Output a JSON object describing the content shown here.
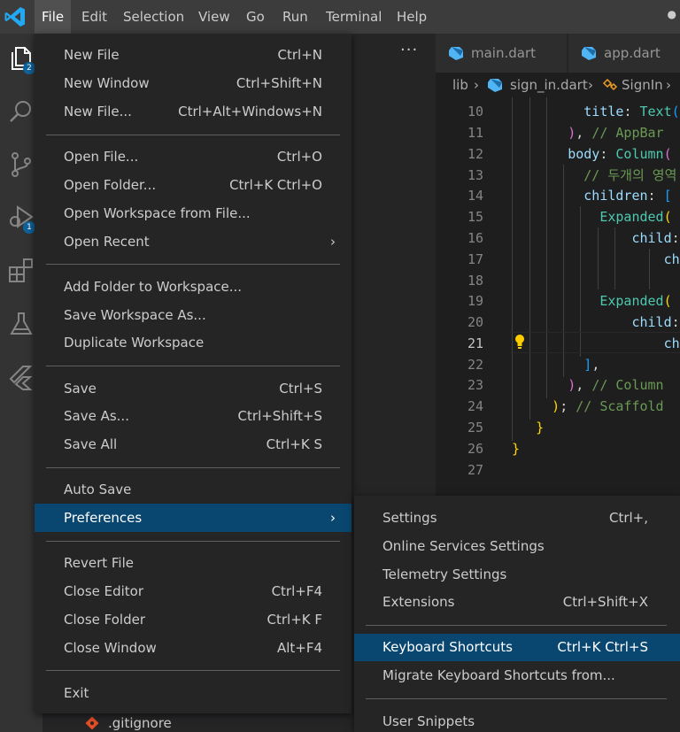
{
  "menubar": {
    "items": [
      "File",
      "Edit",
      "Selection",
      "View",
      "Go",
      "Run",
      "Terminal",
      "Help"
    ],
    "more": "●"
  },
  "activity": {
    "explorer_badge": "2",
    "debug_badge": "1",
    "accent": "#0e639c"
  },
  "sidebar": {
    "more": "···",
    "tree_item": ".gitignore"
  },
  "tabs": [
    {
      "label": "main.dart"
    },
    {
      "label": "app.dart"
    }
  ],
  "breadcrumb": {
    "folder": "lib",
    "file": "sign_in.dart",
    "symbol": "SignIn"
  },
  "editor": {
    "line_numbers": [
      "10",
      "11",
      "12",
      "13",
      "14",
      "15",
      "16",
      "17",
      "18",
      "19",
      "20",
      "21",
      "22",
      "23",
      "24",
      "25",
      "26",
      "27"
    ],
    "current_line": "21"
  },
  "file_menu": {
    "items": [
      {
        "label": "New File",
        "key": "Ctrl+N"
      },
      {
        "label": "New Window",
        "key": "Ctrl+Shift+N"
      },
      {
        "label": "New File...",
        "key": "Ctrl+Alt+Windows+N"
      },
      {
        "label": "Open File...",
        "key": "Ctrl+O"
      },
      {
        "label": "Open Folder...",
        "key": "Ctrl+K Ctrl+O"
      },
      {
        "label": "Open Workspace from File...",
        "key": ""
      },
      {
        "label": "Open Recent",
        "key": ""
      },
      {
        "label": "Add Folder to Workspace...",
        "key": ""
      },
      {
        "label": "Save Workspace As...",
        "key": ""
      },
      {
        "label": "Duplicate Workspace",
        "key": ""
      },
      {
        "label": "Save",
        "key": "Ctrl+S"
      },
      {
        "label": "Save As...",
        "key": "Ctrl+Shift+S"
      },
      {
        "label": "Save All",
        "key": "Ctrl+K S"
      },
      {
        "label": "Auto Save",
        "key": ""
      },
      {
        "label": "Preferences",
        "key": ""
      },
      {
        "label": "Revert File",
        "key": ""
      },
      {
        "label": "Close Editor",
        "key": "Ctrl+F4"
      },
      {
        "label": "Close Folder",
        "key": "Ctrl+K F"
      },
      {
        "label": "Close Window",
        "key": "Alt+F4"
      },
      {
        "label": "Exit",
        "key": ""
      }
    ]
  },
  "pref_menu": {
    "items": [
      {
        "label": "Settings",
        "key": "Ctrl+,"
      },
      {
        "label": "Online Services Settings",
        "key": ""
      },
      {
        "label": "Telemetry Settings",
        "key": ""
      },
      {
        "label": "Extensions",
        "key": "Ctrl+Shift+X"
      },
      {
        "label": "Keyboard Shortcuts",
        "key": "Ctrl+K Ctrl+S"
      },
      {
        "label": "Migrate Keyboard Shortcuts from...",
        "key": ""
      },
      {
        "label": "User Snippets",
        "key": ""
      }
    ]
  },
  "submenu_arrow": "›",
  "colors": {
    "highlight": "#094771",
    "menu_bg": "#252526",
    "menubar_bg": "#3c3c3c",
    "activitybar_bg": "#333333",
    "editor_bg": "#1e1e1e"
  }
}
